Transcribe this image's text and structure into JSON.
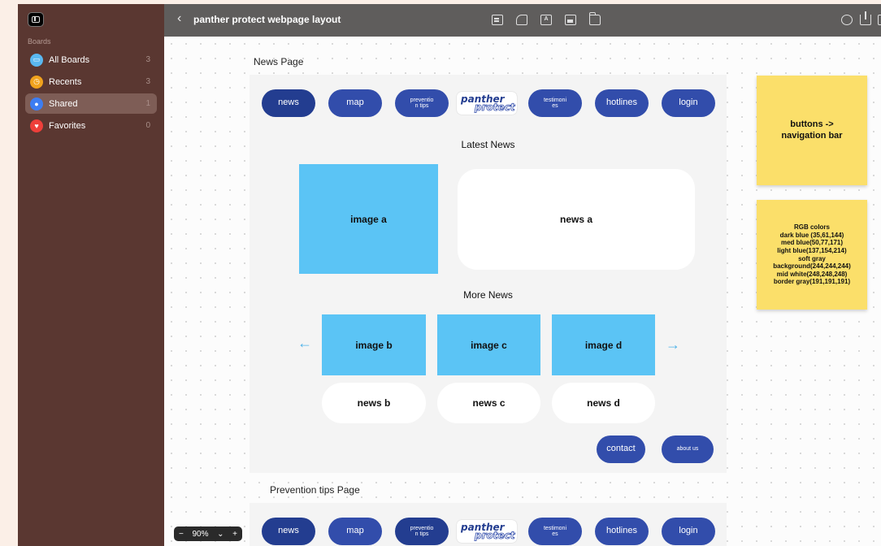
{
  "sidebar": {
    "section": "Boards",
    "items": [
      {
        "label": "All Boards",
        "count": "3",
        "color": "#5ab8f0"
      },
      {
        "label": "Recents",
        "count": "3",
        "color": "#f0a21d"
      },
      {
        "label": "Shared",
        "count": "1",
        "color": "#3d7df2"
      },
      {
        "label": "Favorites",
        "count": "0",
        "color": "#ee3f3a"
      }
    ]
  },
  "toolbar": {
    "back": "‹",
    "title": "panther protect webpage layout",
    "text_tool_glyph": "A"
  },
  "pages": [
    {
      "title": "News Page",
      "nav": [
        "news",
        "map",
        "preventio\nn tips",
        "testimoni\nes",
        "hotlines",
        "login"
      ],
      "logo_top": "panther",
      "logo_bottom": "protect",
      "latest_heading": "Latest News",
      "image_a": "image a",
      "news_a": "news a",
      "more_heading": "More News",
      "images": [
        "image b",
        "image c",
        "image d"
      ],
      "news": [
        "news b",
        "news c",
        "news d"
      ],
      "arrow_left": "←",
      "arrow_right": "→",
      "footer": [
        "contact",
        "about us"
      ]
    },
    {
      "title": "Prevention tips Page",
      "nav": [
        "news",
        "map",
        "preventio\nn tips",
        "testimoni\nes",
        "hotlines",
        "login"
      ],
      "logo_top": "panther",
      "logo_bottom": "protect"
    }
  ],
  "stickies": [
    {
      "text": "buttons ->\nnavigation bar"
    },
    {
      "text": "RGB colors\ndark blue (35,61,144)\nmed blue(50,77,171)\nlight blue(137,154,214)\nsoft gray\nbackground(244,244,244)\nmid white(248,248,248)\nborder gray(191,191,191)"
    }
  ],
  "zoom": {
    "minus": "−",
    "value": "90%",
    "chevron": "⌄",
    "plus": "+"
  },
  "colors": {
    "dark_blue": "#233d90",
    "med_blue": "#324dab",
    "light_blue": "#5bc4f5",
    "sticky": "#fbdf6a",
    "sidebar": "#5a3731"
  }
}
